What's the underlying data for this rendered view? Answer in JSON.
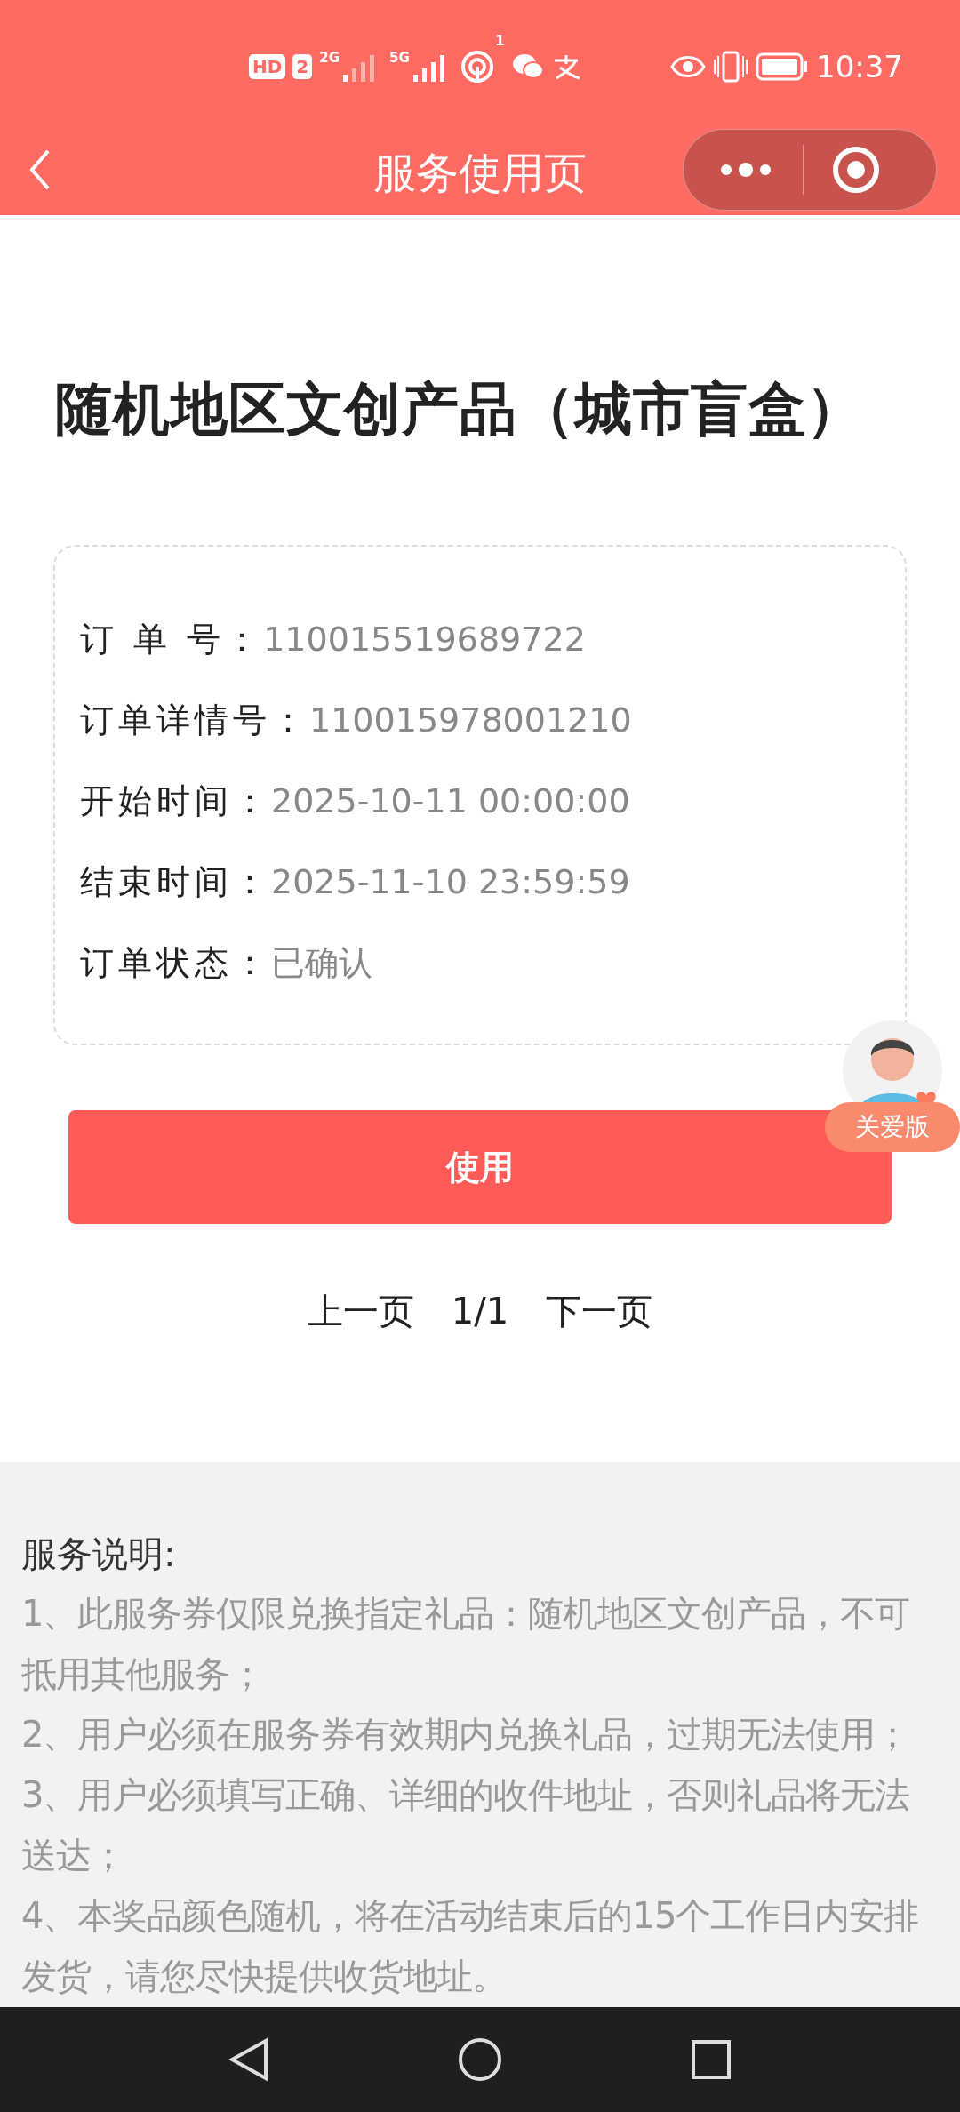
{
  "status_bar": {
    "badges": [
      "HD",
      "2"
    ],
    "networks": [
      "2G",
      "5G"
    ],
    "hotspot_count": "1",
    "time": "10:37"
  },
  "header": {
    "title": "服务使用页"
  },
  "product_title": "随机地区文创产品（城市盲盒）",
  "order": [
    {
      "label": "订 单 号：",
      "value": "110015519689722"
    },
    {
      "label": "订单详情号：",
      "value": "110015978001210"
    },
    {
      "label": "开始时间：",
      "value": "2025-10-11 00:00:00"
    },
    {
      "label": "结束时间：",
      "value": "2025-11-10 23:59:59"
    },
    {
      "label": "订单状态：",
      "value": "已确认"
    }
  ],
  "use_button": "使用",
  "pager": {
    "prev": "上一页",
    "page": "1/1",
    "next": "下一页"
  },
  "care_badge": "关爱版",
  "notes": {
    "heading": "服务说明:",
    "lines": [
      "1、此服务券仅限兑换指定礼品：随机地区文创产品，不可抵用其他服务；",
      "2、用户必须在服务券有效期内兑换礼品，过期无法使用；",
      "3、用户必须填写正确、详细的收件地址，否则礼品将无法送达；",
      "4、本奖品颜色随机，将在活动结束后的15个工作日内安排发货，请您尽快提供收货地址。"
    ]
  }
}
